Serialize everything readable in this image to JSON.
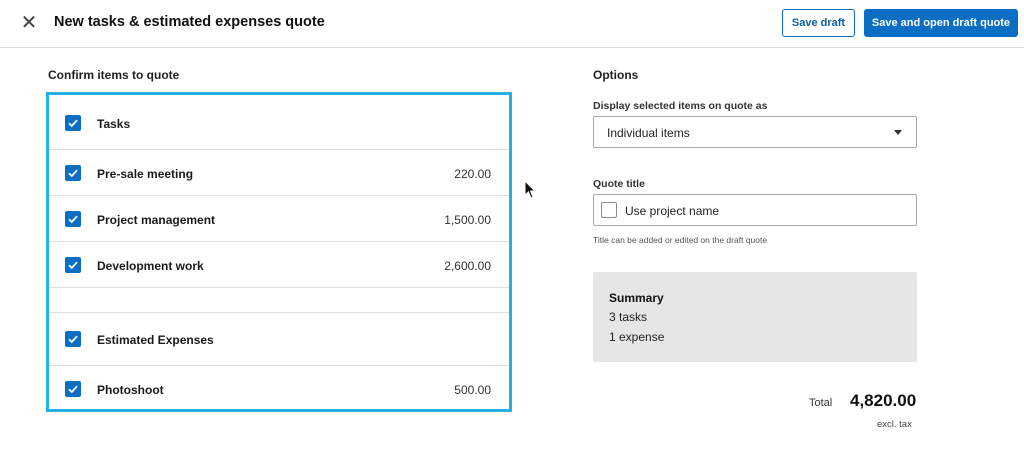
{
  "header": {
    "title": "New tasks & estimated expenses quote",
    "close_glyph": "✕",
    "save_draft_label": "Save draft",
    "save_open_label": "Save and open draft quote"
  },
  "confirm": {
    "heading": "Confirm items to quote",
    "tasks_group": {
      "label": "Tasks",
      "checked": true,
      "items": [
        {
          "label": "Pre-sale meeting",
          "amount": "220.00",
          "checked": true
        },
        {
          "label": "Project management",
          "amount": "1,500.00",
          "checked": true
        },
        {
          "label": "Development work",
          "amount": "2,600.00",
          "checked": true
        }
      ]
    },
    "expenses_group": {
      "label": "Estimated Expenses",
      "checked": true,
      "items": [
        {
          "label": "Photoshoot",
          "amount": "500.00",
          "checked": true
        }
      ]
    }
  },
  "options": {
    "heading": "Options",
    "display_label": "Display selected items on quote as",
    "display_value": "Individual items",
    "quote_title_label": "Quote title",
    "use_project_name_label": "Use project name",
    "use_project_name_checked": false,
    "hint": "Title can be added or edited on the draft quote"
  },
  "summary": {
    "title": "Summary",
    "tasks": "3 tasks",
    "expenses": "1 expense"
  },
  "total": {
    "label": "Total",
    "value": "4,820.00",
    "note": "excl. tax"
  },
  "colors": {
    "accent": "#0a6ec4",
    "highlight_border": "#26b0e4",
    "summary_bg": "#e6e6e6"
  },
  "icons": {
    "close": "close-icon",
    "check": "checkmark-icon",
    "caret": "chevron-down-icon",
    "pointer": "mouse-pointer-icon"
  }
}
